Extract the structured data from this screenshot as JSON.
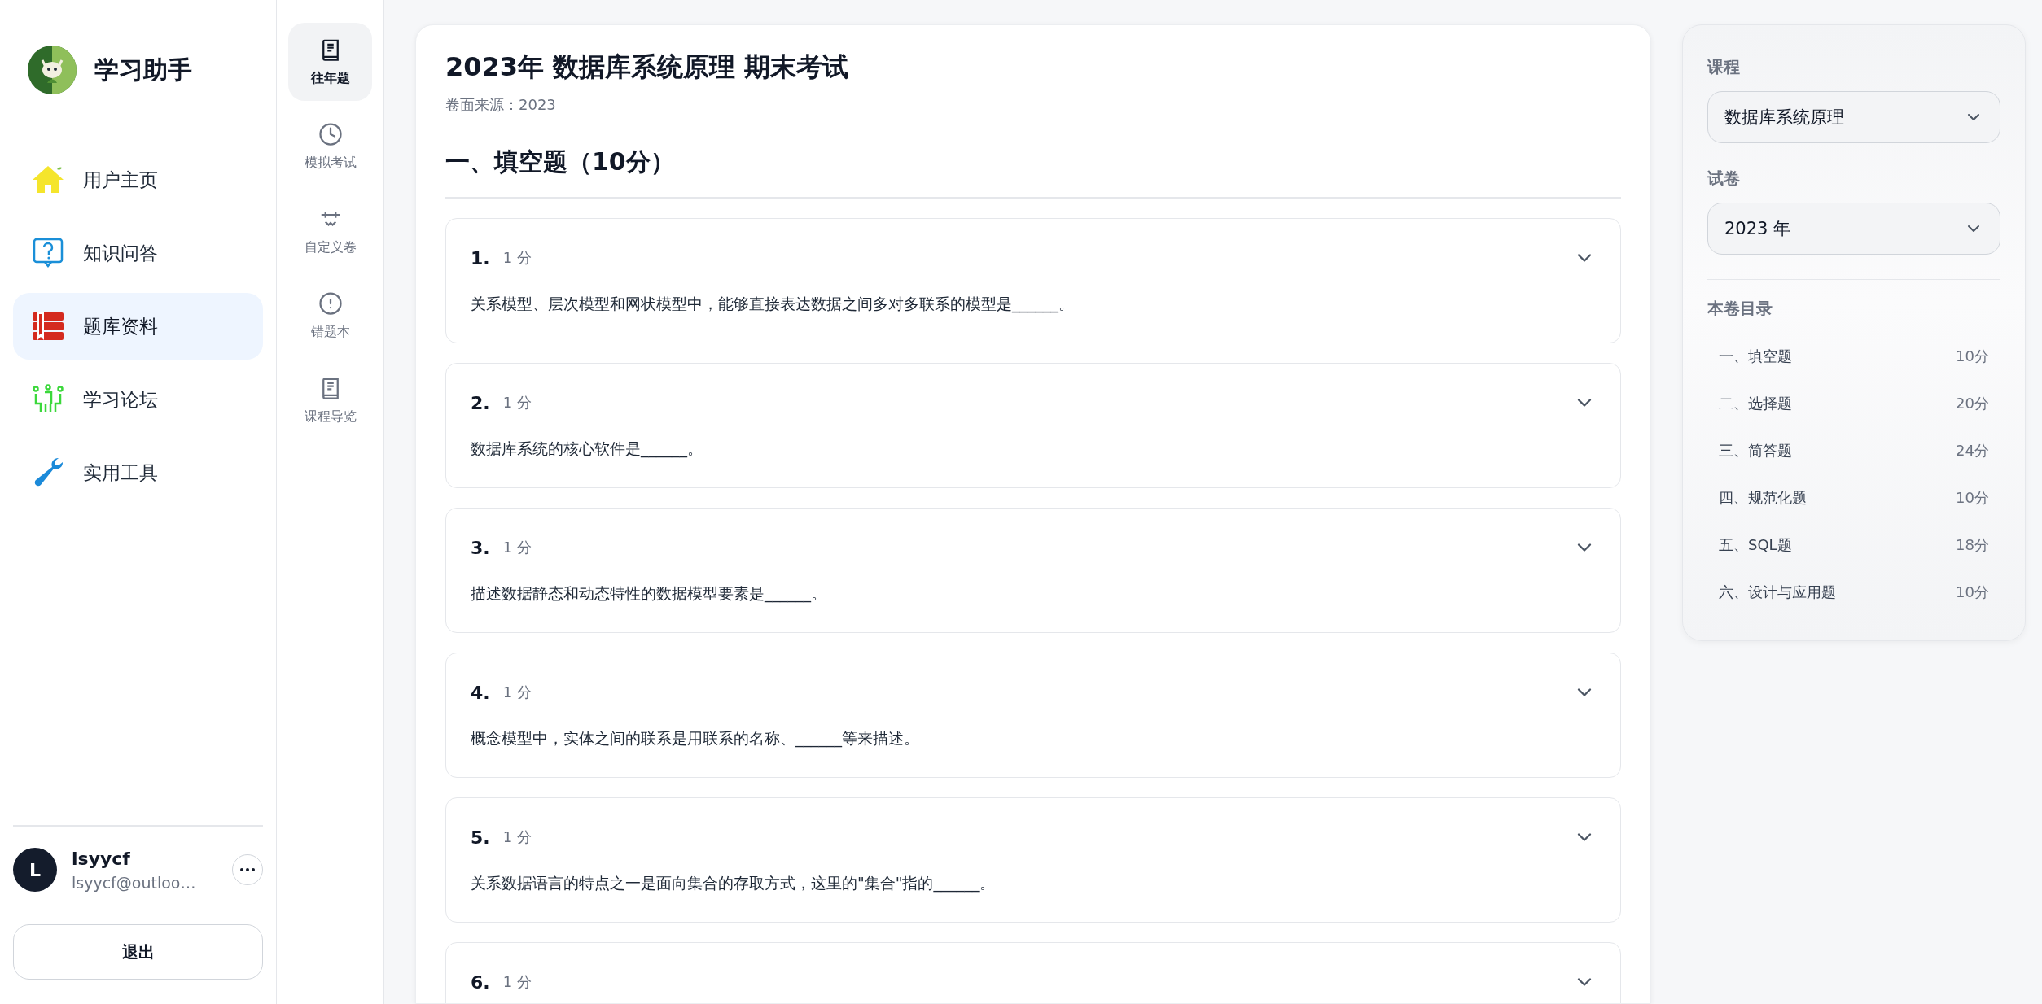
{
  "app": {
    "title": "学习助手"
  },
  "nav": [
    {
      "label": "用户主页",
      "selected": false
    },
    {
      "label": "知识问答",
      "selected": false
    },
    {
      "label": "题库资料",
      "selected": true
    },
    {
      "label": "学习论坛",
      "selected": false
    },
    {
      "label": "实用工具",
      "selected": false
    }
  ],
  "user": {
    "initial": "L",
    "name": "lsyycf",
    "email": "lsyycf@outloo…",
    "logout": "退出"
  },
  "rail": [
    {
      "label": "往年题",
      "selected": true
    },
    {
      "label": "模拟考试",
      "selected": false
    },
    {
      "label": "自定义卷",
      "selected": false
    },
    {
      "label": "错题本",
      "selected": false
    },
    {
      "label": "课程导览",
      "selected": false
    }
  ],
  "exam": {
    "title": "2023年 数据库系统原理 期末考试",
    "source": "卷面来源：2023",
    "section": "一、填空题（10分）",
    "questions": [
      {
        "number": "1.",
        "score": "1 分",
        "text": "关系模型、层次模型和网状模型中，能够直接表达数据之间多对多联系的模型是______。"
      },
      {
        "number": "2.",
        "score": "1 分",
        "text": "数据库系统的核心软件是______。"
      },
      {
        "number": "3.",
        "score": "1 分",
        "text": "描述数据静态和动态特性的数据模型要素是______。"
      },
      {
        "number": "4.",
        "score": "1 分",
        "text": "概念模型中，实体之间的联系是用联系的名称、______等来描述。"
      },
      {
        "number": "5.",
        "score": "1 分",
        "text": "关系数据语言的特点之一是面向集合的存取方式，这里的\"集合\"指的______。"
      },
      {
        "number": "6.",
        "score": "1 分"
      }
    ]
  },
  "panel": {
    "course_label": "课程",
    "course": "数据库系统原理",
    "paper_label": "试卷",
    "paper": "2023 年",
    "toc_title": "本卷目录",
    "toc": [
      {
        "name": "一、填空题",
        "score": "10分"
      },
      {
        "name": "二、选择题",
        "score": "20分"
      },
      {
        "name": "三、简答题",
        "score": "24分"
      },
      {
        "name": "四、规范化题",
        "score": "10分"
      },
      {
        "name": "五、SQL题",
        "score": "18分"
      },
      {
        "name": "六、设计与应用题",
        "score": "10分"
      }
    ]
  }
}
